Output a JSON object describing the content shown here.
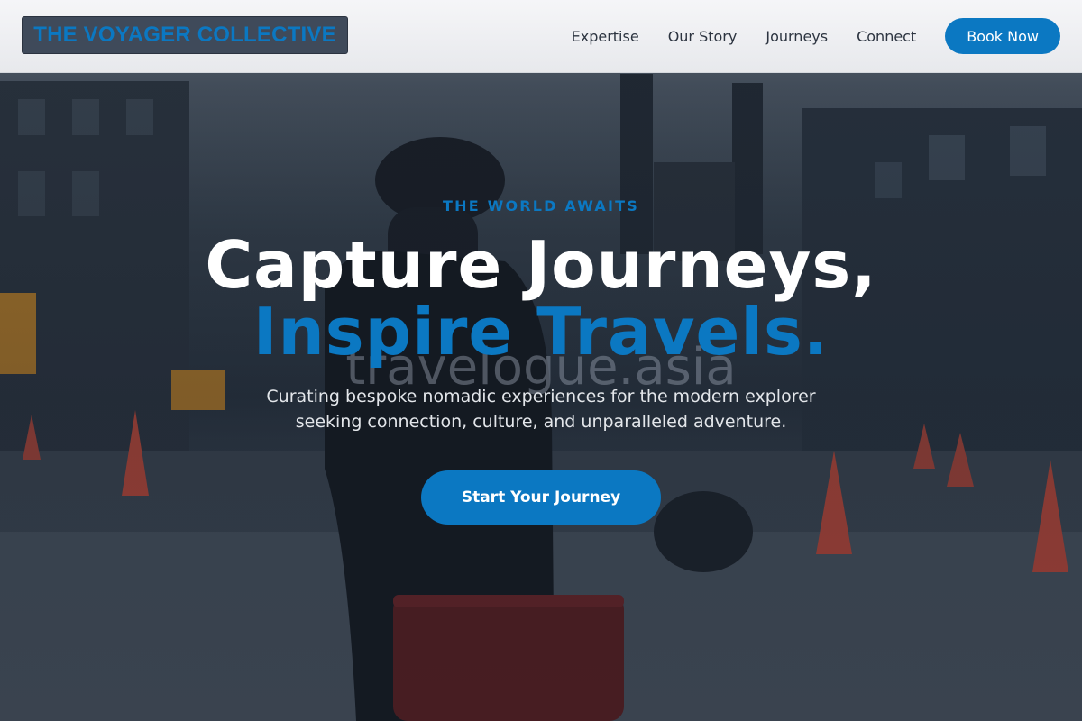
{
  "header": {
    "logo_text": "THE VOYAGER COLLECTIVE",
    "nav": [
      {
        "label": "Expertise"
      },
      {
        "label": "Our Story"
      },
      {
        "label": "Journeys"
      },
      {
        "label": "Connect"
      }
    ],
    "cta_label": "Book Now"
  },
  "hero": {
    "eyebrow": "THE WORLD AWAITS",
    "headline_line1": "Capture Journeys,",
    "headline_line2": "Inspire Travels.",
    "watermark": "travelogue.asia",
    "subtext_line1": "Curating bespoke nomadic experiences for the modern explorer",
    "subtext_line2": "seeking connection, culture, and unparalleled adventure.",
    "cta_label": "Start Your Journey"
  },
  "colors": {
    "accent": "#0b78c2",
    "header_bg": "#f3f4f6",
    "logo_bg": "#3f4a5a",
    "hero_text": "#ffffff"
  },
  "background_image": "traveler-with-red-suitcase-city-street"
}
